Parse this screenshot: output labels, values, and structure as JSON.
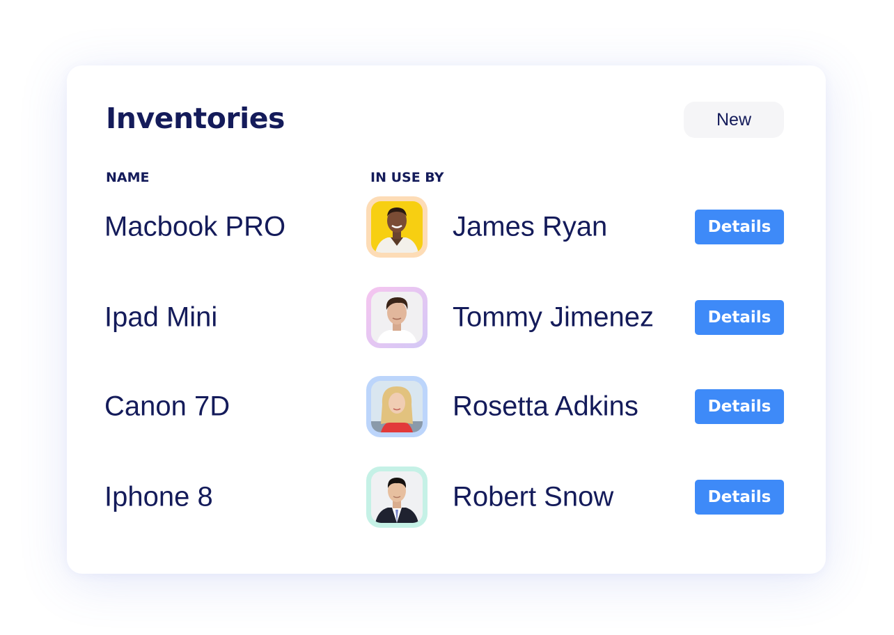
{
  "card": {
    "title": "Inventories",
    "new_button_label": "New"
  },
  "columns": {
    "name": "NAME",
    "in_use_by": "IN USE BY"
  },
  "rows": [
    {
      "name": "Macbook PRO",
      "user": "James Ryan",
      "details_label": "Details",
      "avatar_icon": "person-photo-icon"
    },
    {
      "name": "Ipad Mini",
      "user": "Tommy Jimenez",
      "details_label": "Details",
      "avatar_icon": "person-photo-icon"
    },
    {
      "name": "Canon 7D",
      "user": "Rosetta Adkins",
      "details_label": "Details",
      "avatar_icon": "person-photo-icon"
    },
    {
      "name": "Iphone 8",
      "user": "Robert Snow",
      "details_label": "Details",
      "avatar_icon": "person-photo-icon"
    }
  ],
  "colors": {
    "text": "#141b5a",
    "accent": "#3e8af8",
    "new_button_bg": "#f5f5f7",
    "avatar_frames": [
      "#fddcb6",
      "#e6c6f4",
      "#bcd5fb",
      "#c5f1e6"
    ],
    "avatar_photo_bgs": [
      "#f7cf12",
      "#f1f0f2",
      "#d9e6f0",
      "#f0f1f3"
    ]
  }
}
